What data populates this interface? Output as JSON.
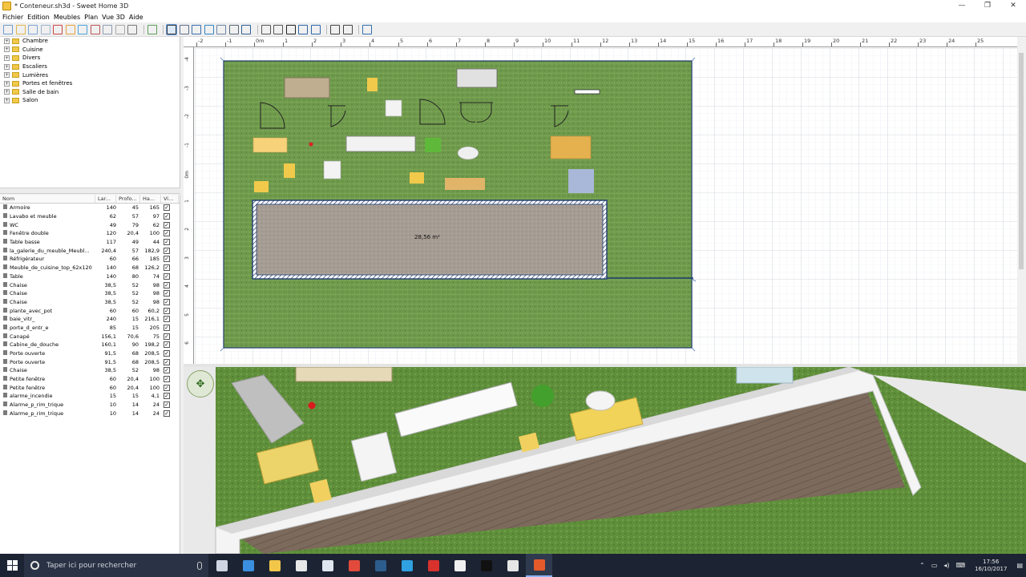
{
  "window": {
    "title": "* Conteneur.sh3d - Sweet Home 3D",
    "min": "—",
    "max": "❐",
    "close": "✕"
  },
  "menu": [
    "Fichier",
    "Edition",
    "Meubles",
    "Plan",
    "Vue 3D",
    "Aide"
  ],
  "toolbar_icons": [
    "new-icon",
    "open-icon",
    "save-icon",
    "save-as-icon",
    "cut-tool-icon",
    "undo-icon",
    "redo-icon",
    "cut-icon",
    "copy-icon",
    "paste-icon",
    "delete-icon",
    "sep",
    "add-furniture-icon",
    "sep",
    "select-icon",
    "pan-icon",
    "create-walls-icon",
    "create-rooms-icon",
    "create-polylines-icon",
    "create-dimensions-icon",
    "create-labels-icon",
    "sep",
    "text-style-icon",
    "text-italic-icon",
    "text-bold-icon",
    "zoom-in-icon",
    "zoom-out-icon",
    "sep",
    "photo-icon",
    "video-icon",
    "sep",
    "help-icon"
  ],
  "catalog": [
    "Chambre",
    "Cuisine",
    "Divers",
    "Escaliers",
    "Lumières",
    "Portes et fenêtres",
    "Salle de bain",
    "Salon"
  ],
  "furniture_table": {
    "headers": [
      "Nom",
      "Lar...",
      "Profo...",
      "Ha...",
      "Vi..."
    ],
    "rows": [
      {
        "name": "Armoire",
        "w": "140",
        "d": "45",
        "h": "165"
      },
      {
        "name": "Lavabo et meuble",
        "w": "62",
        "d": "57",
        "h": "97"
      },
      {
        "name": "WC",
        "w": "49",
        "d": "79",
        "h": "62"
      },
      {
        "name": "Fenêtre double",
        "w": "120",
        "d": "20,4",
        "h": "100"
      },
      {
        "name": "Table basse",
        "w": "117",
        "d": "49",
        "h": "44"
      },
      {
        "name": "la_galerie_du_meuble_Meubl...",
        "w": "240,4",
        "d": "57",
        "h": "182,9"
      },
      {
        "name": "Réfrigérateur",
        "w": "60",
        "d": "66",
        "h": "185"
      },
      {
        "name": "Meuble_de_cuisine_top_62x120",
        "w": "140",
        "d": "68",
        "h": "126,2"
      },
      {
        "name": "Table",
        "w": "140",
        "d": "80",
        "h": "74"
      },
      {
        "name": "Chaise",
        "w": "38,5",
        "d": "52",
        "h": "98"
      },
      {
        "name": "Chaise",
        "w": "38,5",
        "d": "52",
        "h": "98"
      },
      {
        "name": "Chaise",
        "w": "38,5",
        "d": "52",
        "h": "98"
      },
      {
        "name": "plante_avec_pot",
        "w": "60",
        "d": "60",
        "h": "60,2"
      },
      {
        "name": "baie_vitr_",
        "w": "240",
        "d": "15",
        "h": "216,1"
      },
      {
        "name": "porte_d_entr_e",
        "w": "85",
        "d": "15",
        "h": "205"
      },
      {
        "name": "Canapé",
        "w": "156,1",
        "d": "70,6",
        "h": "75"
      },
      {
        "name": "Cabine_de_douche",
        "w": "160,1",
        "d": "90",
        "h": "198,2"
      },
      {
        "name": "Porte ouverte",
        "w": "91,5",
        "d": "68",
        "h": "208,5"
      },
      {
        "name": "Porte ouverte",
        "w": "91,5",
        "d": "68",
        "h": "208,5"
      },
      {
        "name": "Chaise",
        "w": "38,5",
        "d": "52",
        "h": "98"
      },
      {
        "name": "Petite fenêtre",
        "w": "60",
        "d": "20,4",
        "h": "100"
      },
      {
        "name": "Petite fenêtre",
        "w": "60",
        "d": "20,4",
        "h": "100"
      },
      {
        "name": "alarme_incendie",
        "w": "15",
        "d": "15",
        "h": "4,1"
      },
      {
        "name": "Alarme_p_rim_trique",
        "w": "10",
        "d": "14",
        "h": "24"
      },
      {
        "name": "Alarme_p_rim_trique",
        "w": "10",
        "d": "14",
        "h": "24"
      }
    ],
    "visible_mark": "✓"
  },
  "plan": {
    "ruler_top": [
      "-2",
      "-1",
      "0m",
      "1",
      "2",
      "3",
      "4",
      "5",
      "6",
      "7",
      "8",
      "9",
      "10",
      "11",
      "12",
      "13",
      "14",
      "15",
      "16",
      "17",
      "18",
      "19",
      "20",
      "21",
      "22",
      "23",
      "24",
      "25"
    ],
    "ruler_left": [
      "-4",
      "-3",
      "-2",
      "-1",
      "0m",
      "1",
      "2",
      "3",
      "4",
      "5",
      "6"
    ],
    "room_area": "28,56 m²",
    "colors": {
      "grass": "#6f9a4c",
      "floor": "#a59c93",
      "wall": "#1e3a6e",
      "grid": "#e6e9ee"
    }
  },
  "taskbar": {
    "search_placeholder": "Taper ici pour rechercher",
    "time": "17:56",
    "date": "16/10/2017",
    "apps": [
      {
        "name": "task-view-icon",
        "color": "#cfd6e2"
      },
      {
        "name": "edge-icon",
        "color": "#3b8fe0"
      },
      {
        "name": "file-explorer-icon",
        "color": "#f2c649"
      },
      {
        "name": "store-icon",
        "color": "#e8e8e8"
      },
      {
        "name": "mail-icon",
        "color": "#dfe6ef"
      },
      {
        "name": "chrome-icon",
        "color": "#e24a3b"
      },
      {
        "name": "steam-icon",
        "color": "#2d5d8c"
      },
      {
        "name": "app-blue-icon",
        "color": "#2fa0e0"
      },
      {
        "name": "app-red-icon",
        "color": "#d9322d"
      },
      {
        "name": "app-dark-icon",
        "color": "#f0f0f0"
      },
      {
        "name": "app-plus-icon",
        "color": "#111111"
      },
      {
        "name": "calculator-icon",
        "color": "#e6e6e6"
      },
      {
        "name": "sweet-home-3d-icon",
        "color": "#e45a2a"
      }
    ]
  }
}
